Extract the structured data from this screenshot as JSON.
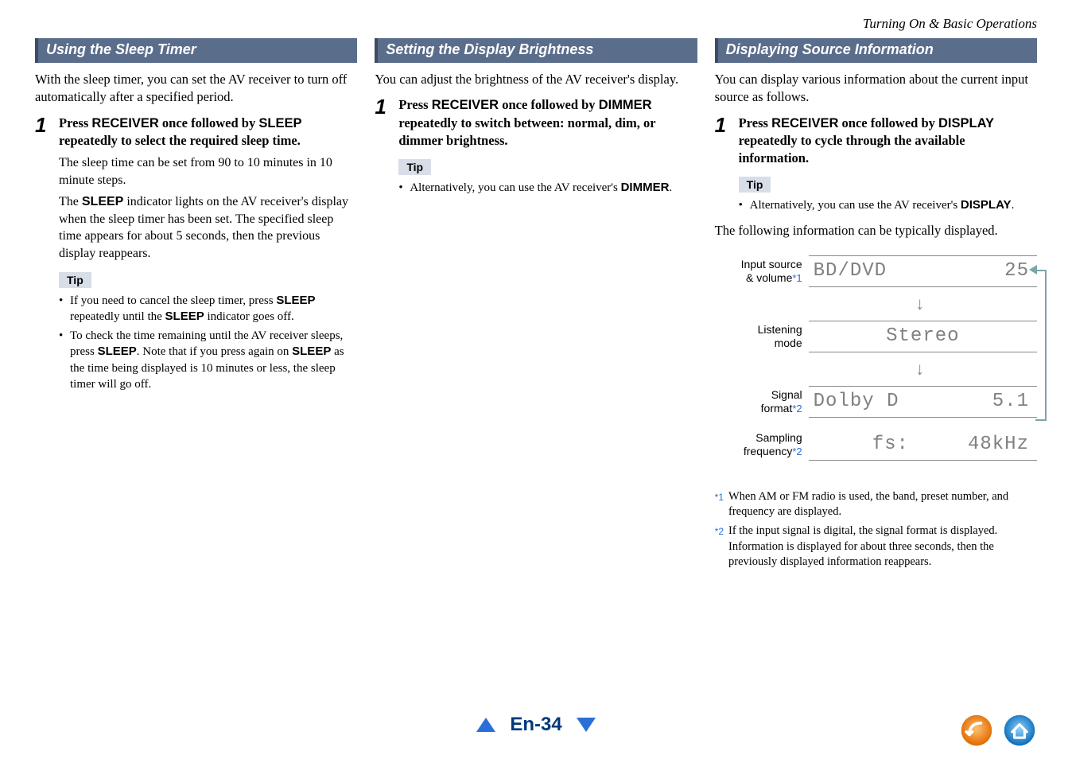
{
  "breadcrumb": "Turning On & Basic Operations",
  "col1": {
    "heading": "Using the Sleep Timer",
    "intro": "With the sleep timer, you can set the AV receiver to turn off automatically after a specified period.",
    "step_num": "1",
    "step_main_pre": "Press ",
    "step_main_k1": "RECEIVER",
    "step_main_mid": " once followed by ",
    "step_main_k2": "SLEEP",
    "step_main_post": " repeatedly to select the required sleep time.",
    "step_sub1": "The sleep time can be set from 90 to 10 minutes in 10 minute steps.",
    "step_sub2_pre": "The ",
    "step_sub2_k": "SLEEP",
    "step_sub2_post": " indicator lights on the AV receiver's display when the sleep timer has been set. The specified sleep time appears for about 5 seconds, then the previous display reappears.",
    "tip_label": "Tip",
    "tip1_pre": "If you need to cancel the sleep timer, press ",
    "tip1_k": "SLEEP",
    "tip1_mid": " repeatedly until the ",
    "tip1_k2": "SLEEP",
    "tip1_post": " indicator goes off.",
    "tip2_pre": "To check the time remaining until the AV receiver sleeps, press ",
    "tip2_k": "SLEEP",
    "tip2_mid": ". Note that if you press again on ",
    "tip2_k2": "SLEEP",
    "tip2_post": " as the time being displayed is 10 minutes or less, the sleep timer will go off."
  },
  "col2": {
    "heading": "Setting the Display Brightness",
    "intro": "You can adjust the brightness of the AV receiver's display.",
    "step_num": "1",
    "step_main_pre": "Press ",
    "step_main_k1": "RECEIVER",
    "step_main_mid": " once followed by ",
    "step_main_k2": "DIMMER",
    "step_main_post": " repeatedly to switch between: normal, dim, or dimmer brightness.",
    "tip_label": "Tip",
    "tip1_pre": "Alternatively, you can use the AV receiver's ",
    "tip1_k": "DIMMER",
    "tip1_post": "."
  },
  "col3": {
    "heading": "Displaying Source Information",
    "intro": "You can display various information about the current input source as follows.",
    "step_num": "1",
    "step_main_pre": "Press ",
    "step_main_k1": "RECEIVER",
    "step_main_mid": " once followed by ",
    "step_main_k2": "DISPLAY",
    "step_main_post": " repeatedly to cycle through the available information.",
    "tip_label": "Tip",
    "tip1_pre": "Alternatively, you can use the AV receiver's ",
    "tip1_k": "DISPLAY",
    "tip1_post": ".",
    "after_tip": "The following information can be typically displayed.",
    "disp": {
      "row1_label1": "Input source",
      "row1_label2": "& volume",
      "row1_star": "*1",
      "row1_left": "BD/DVD",
      "row1_right": "25",
      "row2_label1": "Listening",
      "row2_label2": "mode",
      "row2_center": "Stereo",
      "row3_label1": "Signal",
      "row3_label2": "format",
      "row3_star": "*2",
      "row3_left": "Dolby D",
      "row3_right": "5.1",
      "row4_label1": "Sampling",
      "row4_label2": "frequency",
      "row4_star": "*2",
      "row4_left": "fs:",
      "row4_right": "48kHz"
    },
    "footnote1_marker": "*1",
    "footnote1_text": "When AM or FM radio is used, the band, preset number, and frequency are displayed.",
    "footnote2_marker": "*2",
    "footnote2_text": "If the input signal is digital, the signal format is displayed. Information is displayed for about three seconds, then the previously displayed information reappears."
  },
  "footer": {
    "page": "En-34"
  }
}
